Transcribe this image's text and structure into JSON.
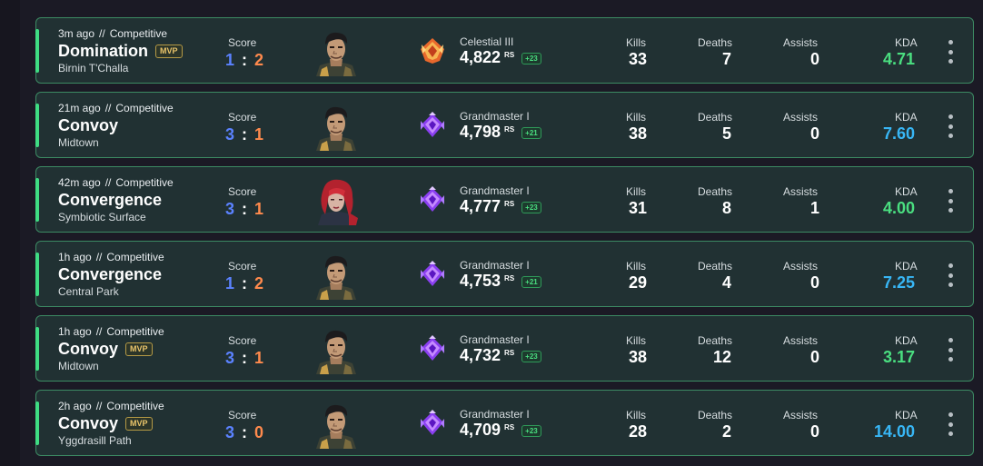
{
  "labels": {
    "score": "Score",
    "kills": "Kills",
    "deaths": "Deaths",
    "assists": "Assists",
    "kda": "KDA",
    "rs_unit": "RS",
    "separator": "//",
    "score_colon": ":",
    "mvp": "MVP"
  },
  "colors": {
    "accent": "#3fdc83",
    "team_blue": "#5b82ff",
    "team_orange": "#ff8a4d",
    "kda_green": "#4ade80",
    "kda_blue": "#38b6f5",
    "mvp_gold": "#e9c46a"
  },
  "matches": [
    {
      "time": "3m ago",
      "queue": "Competitive",
      "mode": "Domination",
      "mvp": true,
      "map": "Birnin T'Challa",
      "score_a": "1",
      "score_b": "2",
      "hero": "punisher-portrait",
      "rank_icon": "celestial-rank-icon",
      "rank_name": "Celestial III",
      "rs": "4,822",
      "rs_delta": "+23",
      "kills": "33",
      "deaths": "7",
      "assists": "0",
      "kda": "4.71",
      "kda_color": "green"
    },
    {
      "time": "21m ago",
      "queue": "Competitive",
      "mode": "Convoy",
      "mvp": false,
      "map": "Midtown",
      "score_a": "3",
      "score_b": "1",
      "hero": "punisher-portrait",
      "rank_icon": "grandmaster-rank-icon",
      "rank_name": "Grandmaster I",
      "rs": "4,798",
      "rs_delta": "+21",
      "kills": "38",
      "deaths": "5",
      "assists": "0",
      "kda": "7.60",
      "kda_color": "blue"
    },
    {
      "time": "42m ago",
      "queue": "Competitive",
      "mode": "Convergence",
      "mvp": false,
      "map": "Symbiotic Surface",
      "score_a": "3",
      "score_b": "1",
      "hero": "red-haired-hero-portrait",
      "rank_icon": "grandmaster-rank-icon",
      "rank_name": "Grandmaster I",
      "rs": "4,777",
      "rs_delta": "+23",
      "kills": "31",
      "deaths": "8",
      "assists": "1",
      "kda": "4.00",
      "kda_color": "green"
    },
    {
      "time": "1h ago",
      "queue": "Competitive",
      "mode": "Convergence",
      "mvp": false,
      "map": "Central Park",
      "score_a": "1",
      "score_b": "2",
      "hero": "punisher-portrait",
      "rank_icon": "grandmaster-rank-icon",
      "rank_name": "Grandmaster I",
      "rs": "4,753",
      "rs_delta": "+21",
      "kills": "29",
      "deaths": "4",
      "assists": "0",
      "kda": "7.25",
      "kda_color": "blue"
    },
    {
      "time": "1h ago",
      "queue": "Competitive",
      "mode": "Convoy",
      "mvp": true,
      "map": "Midtown",
      "score_a": "3",
      "score_b": "1",
      "hero": "punisher-portrait",
      "rank_icon": "grandmaster-rank-icon",
      "rank_name": "Grandmaster I",
      "rs": "4,732",
      "rs_delta": "+23",
      "kills": "38",
      "deaths": "12",
      "assists": "0",
      "kda": "3.17",
      "kda_color": "green"
    },
    {
      "time": "2h ago",
      "queue": "Competitive",
      "mode": "Convoy",
      "mvp": true,
      "map": "Yggdrasill Path",
      "score_a": "3",
      "score_b": "0",
      "hero": "punisher-portrait",
      "rank_icon": "grandmaster-rank-icon",
      "rank_name": "Grandmaster I",
      "rs": "4,709",
      "rs_delta": "+23",
      "kills": "28",
      "deaths": "2",
      "assists": "0",
      "kda": "14.00",
      "kda_color": "blue"
    }
  ]
}
